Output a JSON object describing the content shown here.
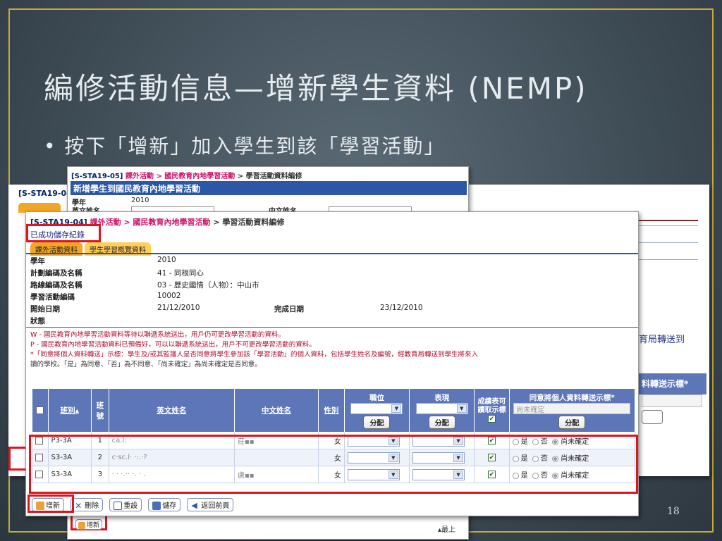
{
  "slide": {
    "title": "編修活動信息—增新學生資料 (NEMP)",
    "bullet": "•  按下「增新」加入學生到該「學習活動」",
    "page_number": "18"
  },
  "back_window": {
    "code_fragment": "[S-STA19-04",
    "right_text": "育局轉送到",
    "right_header": "料轉送示標*"
  },
  "mid_window": {
    "breadcrumb_code": "[S-STA19-05]",
    "breadcrumb_1": "課外活動",
    "breadcrumb_2": "> 國民教育內地學習活動",
    "breadcrumb_3": "> 學習活動資料編修",
    "header": "新增學生到國民教育內地學習活動",
    "year_label": "學年",
    "year_value": "2010",
    "eng_label": "英文姓名",
    "chi_label": "中文姓名",
    "add_button": "增新",
    "top_link": "▴最上"
  },
  "front_window": {
    "breadcrumb_code": "[S-STA19-04]",
    "breadcrumb_1": "課外活動",
    "breadcrumb_2": "> 國民教育內地學習活動",
    "breadcrumb_3": "> 學習活動資料編修",
    "saved_message": "已成功儲存紀錄",
    "tabs": [
      "課外活動資料",
      "學生學習概覽資料"
    ],
    "info": {
      "year_label": "學年",
      "year_value": "2010",
      "plan_label": "計劃編碼及名稱",
      "plan_value": "41 - 同根同心",
      "route_label": "路線編碼及名稱",
      "route_value": "03 - 歷史國情（人物）：中山市",
      "activity_label": "學習活動編碼",
      "activity_value": "10002",
      "start_label": "開始日期",
      "start_value": "21/12/2010",
      "end_label": "完成日期",
      "end_value": "23/12/2010",
      "status_label": "狀態"
    },
    "notes": {
      "line1": "W - 國民教育內地學習活動資料等待以聯遞系統送出，用戶仍可更改學習活動的資料。",
      "line2": "P - 國民教育內地學習活動資料已預備好，可以以聯遞系統送出，用戶不可更改學習活動的資料。",
      "line3": "*「同意將個人資料轉送」示標：學生及/或其監護人是否同意將學生參加該「學習活動」的個人資料，包括學生姓名及編號，經教育局轉送到學生將來入",
      "line4": "讀的學校。「是」為同意、「否」為不同意、「尚未確定」為尚未確定是否同意。"
    },
    "table": {
      "headers": {
        "class": "班別▴",
        "number": "班號",
        "eng": "英文姓名",
        "chi": "中文姓名",
        "gender": "性別",
        "post": "職位",
        "perf": "表現",
        "show": "成績表可讀取示標",
        "consent": "同意將個人資料轉送示標*"
      },
      "consent_select": "尚未確定",
      "assign_button": "分配",
      "rows": [
        {
          "class": "P3-3A",
          "number": "1",
          "eng": "ca.l: ·",
          "chi": "莊▪▪",
          "gender": "女"
        },
        {
          "class": "S3-3A",
          "number": "2",
          "eng": "c·sc.l· ·:.·?",
          "chi": "",
          "gender": "女"
        },
        {
          "class": "S3-3A",
          "number": "3",
          "eng": "· · ·.·· ·. · .",
          "chi": "盧▪▪",
          "gender": "女"
        }
      ],
      "radio_yes": "是",
      "radio_no": "否",
      "radio_undecided": "尚未確定"
    },
    "toolbar": {
      "add": "增新",
      "delete": "刪除",
      "reset": "重設",
      "save": "儲存",
      "back": "返回前頁"
    }
  },
  "colors": {
    "accent_red": "#e0141e",
    "header_blue": "#5c76b8",
    "tab_orange": "#f3a623",
    "frame_gold": "#c7a93a"
  }
}
